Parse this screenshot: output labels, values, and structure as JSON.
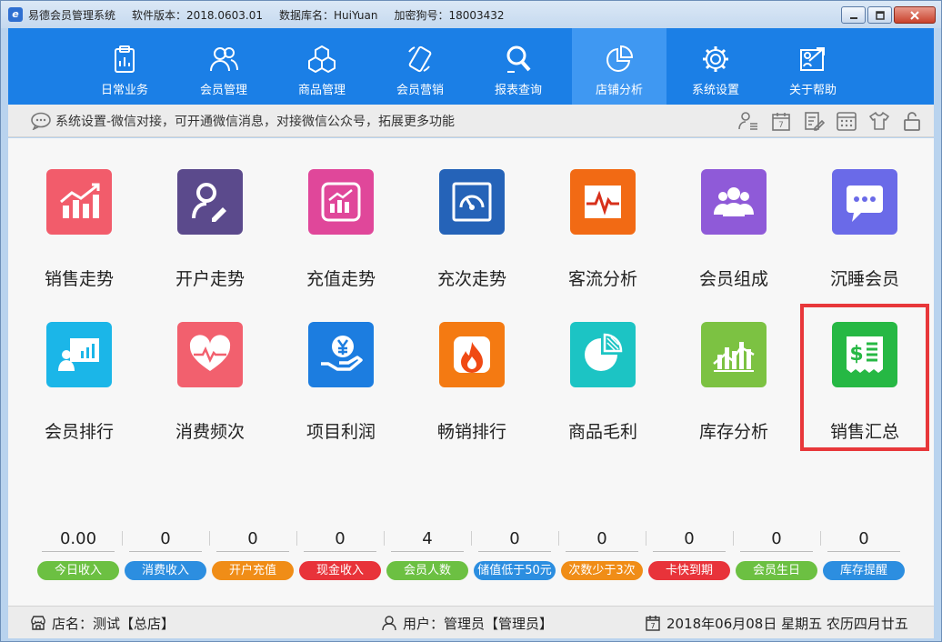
{
  "titlebar": {
    "app_name": "易德会员管理系统",
    "version": "软件版本：2018.0603.01",
    "db_name": "数据库名：HuiYuan",
    "dongle": "加密狗号：18003432",
    "buttons": [
      "minimize",
      "maximize",
      "close"
    ]
  },
  "nav": {
    "items": [
      {
        "label": "日常业务",
        "icon": "clipboard-icon"
      },
      {
        "label": "会员管理",
        "icon": "members-icon"
      },
      {
        "label": "商品管理",
        "icon": "cubes-icon"
      },
      {
        "label": "会员营销",
        "icon": "phone-icon"
      },
      {
        "label": "报表查询",
        "icon": "search-report-icon"
      },
      {
        "label": "店铺分析",
        "icon": "pie-chart-icon",
        "active": true
      },
      {
        "label": "系统设置",
        "icon": "gear-icon"
      },
      {
        "label": "关于帮助",
        "icon": "help-icon"
      }
    ],
    "color": "#1b7fe6",
    "active_color": "#3f98f2"
  },
  "notice": {
    "text": "系统设置-微信对接，可开通微信消息，对接微信公众号，拓展更多功能",
    "tool_icons": [
      "user-list-icon",
      "calendar-icon",
      "edit-icon",
      "calculator-icon",
      "shirt-icon",
      "lock-icon"
    ]
  },
  "tiles": {
    "row1": [
      {
        "label": "销售走势",
        "color": "#f25c6b",
        "icon": "sales-trend-icon"
      },
      {
        "label": "开户走势",
        "color": "#5b4a8c",
        "icon": "new-account-icon"
      },
      {
        "label": "充值走势",
        "color": "#e0479a",
        "icon": "recharge-trend-icon"
      },
      {
        "label": "充次走势",
        "color": "#2563b8",
        "icon": "gauge-icon"
      },
      {
        "label": "客流分析",
        "color": "#f26a14",
        "icon": "pulse-icon"
      },
      {
        "label": "会员组成",
        "color": "#8f5ad8",
        "icon": "group-icon"
      },
      {
        "label": "沉睡会员",
        "color": "#6a6ae8",
        "icon": "chat-bubble-icon"
      }
    ],
    "row2": [
      {
        "label": "会员排行",
        "color": "#1bb6e8",
        "icon": "presentation-icon"
      },
      {
        "label": "消费频次",
        "color": "#f2606e",
        "icon": "heartbeat-icon"
      },
      {
        "label": "项目利润",
        "color": "#1c7de0",
        "icon": "yen-hand-icon"
      },
      {
        "label": "畅销排行",
        "color": "#f47a12",
        "icon": "fire-icon"
      },
      {
        "label": "商品毛利",
        "color": "#1cc4c4",
        "icon": "pie-icon"
      },
      {
        "label": "库存分析",
        "color": "#7cc242",
        "icon": "bar-line-icon"
      },
      {
        "label": "销售汇总",
        "color": "#26b844",
        "icon": "receipt-icon",
        "highlighted": true
      }
    ]
  },
  "stats": [
    {
      "value": "0.00",
      "label": "今日收入",
      "color": "#6cc042"
    },
    {
      "value": "0",
      "label": "消费收入",
      "color": "#2c8ee0"
    },
    {
      "value": "0",
      "label": "开户充值",
      "color": "#f08d17"
    },
    {
      "value": "0",
      "label": "现金收入",
      "color": "#e8333a"
    },
    {
      "value": "4",
      "label": "会员人数",
      "color": "#6cc042"
    },
    {
      "value": "0",
      "label": "储值低于50元",
      "color": "#2c8ee0"
    },
    {
      "value": "0",
      "label": "次数少于3次",
      "color": "#f08d17"
    },
    {
      "value": "0",
      "label": "卡快到期",
      "color": "#e8333a"
    },
    {
      "value": "0",
      "label": "会员生日",
      "color": "#6cc042"
    },
    {
      "value": "0",
      "label": "库存提醒",
      "color": "#2c8ee0"
    }
  ],
  "status": {
    "shop": "店名：测试【总店】",
    "user": "用户：管理员【管理员】",
    "date": "2018年06月08日 星期五 农历四月廿五"
  }
}
